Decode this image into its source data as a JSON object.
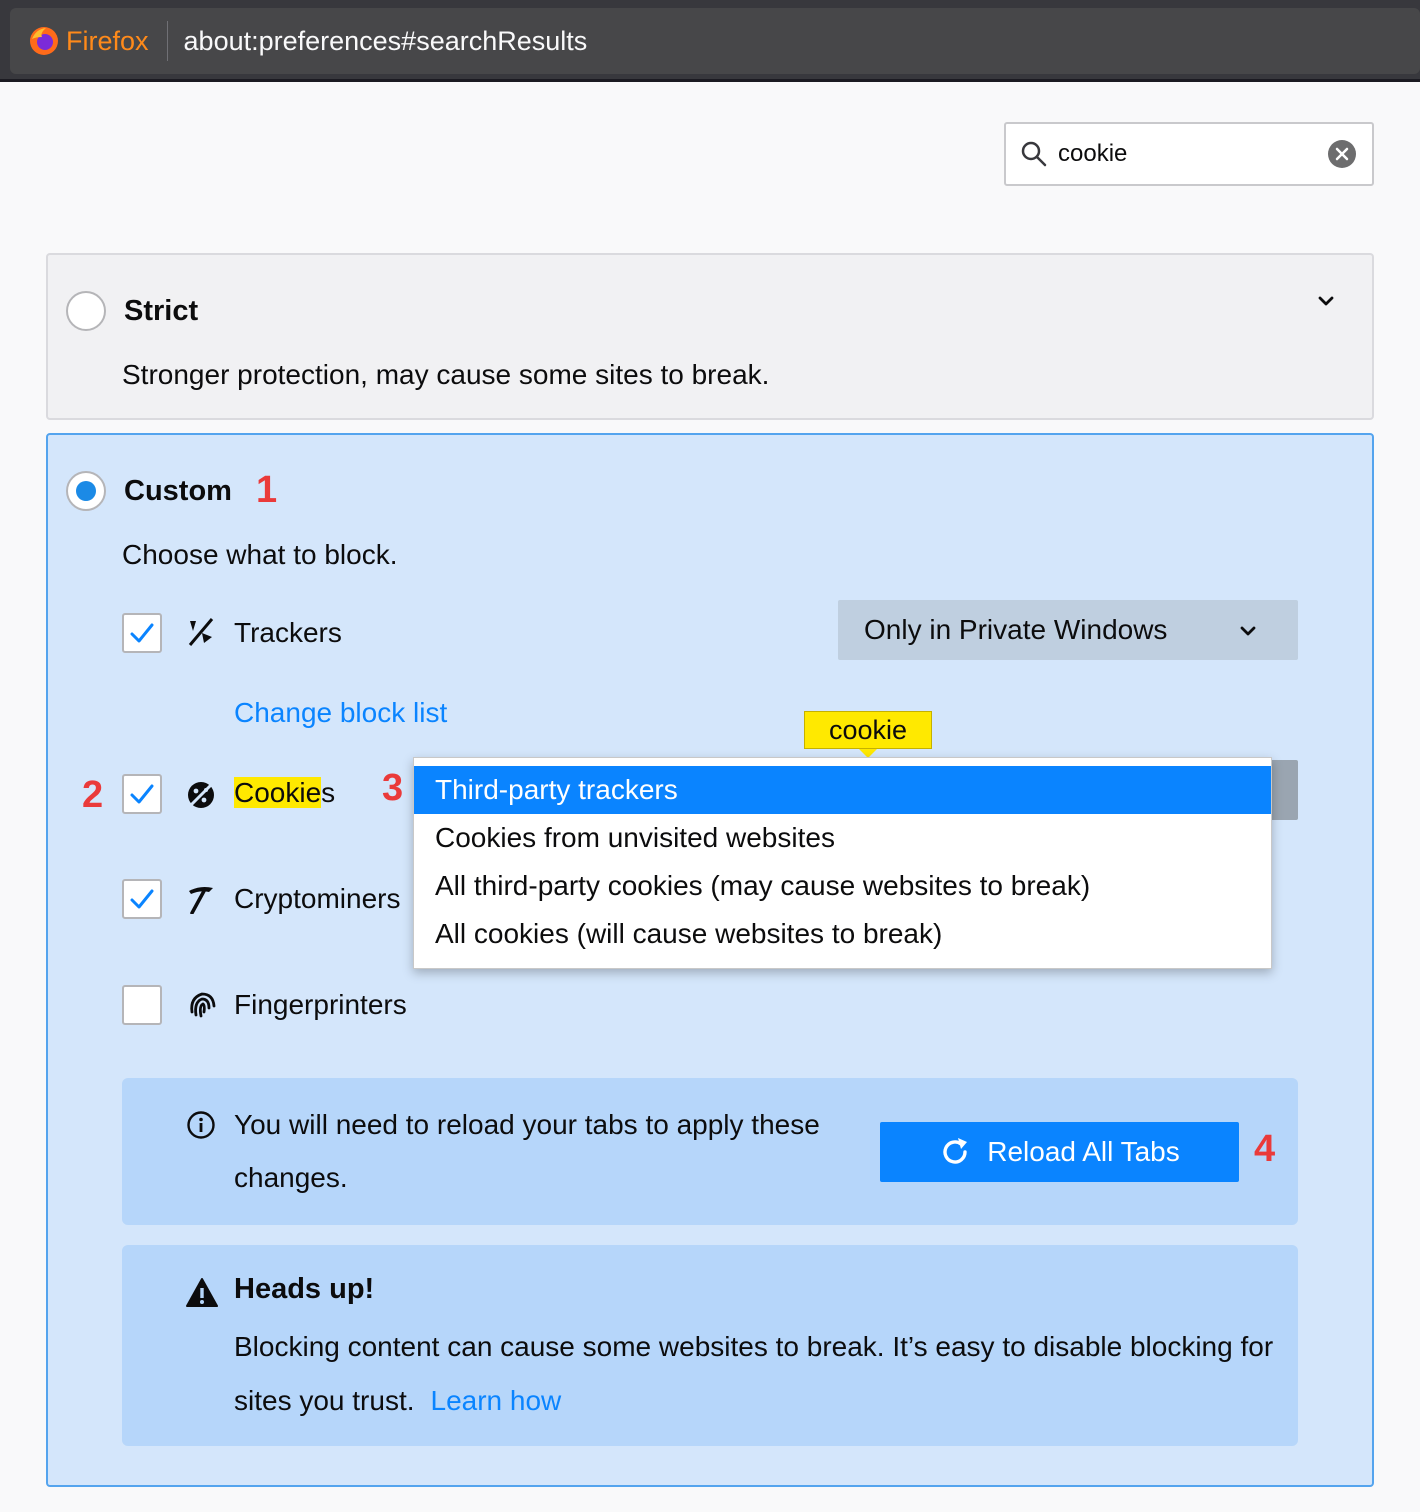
{
  "browser": {
    "brand": "Firefox",
    "url": "about:preferences#searchResults"
  },
  "search": {
    "value": "cookie",
    "icon": "search-icon",
    "clear_icon": "clear-icon"
  },
  "strict": {
    "title": "Strict",
    "description": "Stronger protection, may cause some sites to break.",
    "selected": false
  },
  "custom": {
    "title": "Custom",
    "description": "Choose what to block.",
    "selected": true,
    "annotation": "1"
  },
  "trackers": {
    "label": "Trackers",
    "checked": true,
    "icon": "tracker-icon",
    "select_value": "Only in Private Windows",
    "change_block_list": "Change block list"
  },
  "cookies": {
    "label_highlight": "Cookie",
    "label_rest": "s",
    "checked": true,
    "icon": "cookie-icon",
    "annotation_row": "2",
    "annotation_dropdown": "3",
    "tooltip": "cookie",
    "options": [
      "Third-party trackers",
      "Cookies from unvisited websites",
      "All third-party cookies (may cause websites to break)",
      "All cookies (will cause websites to break)"
    ],
    "selected_index": 0
  },
  "cryptominers": {
    "label": "Cryptominers",
    "checked": true,
    "icon": "cryptominer-icon"
  },
  "fingerprinters": {
    "label": "Fingerprinters",
    "checked": false,
    "icon": "fingerprint-icon"
  },
  "reload": {
    "message": "You will need to reload your tabs to apply these changes.",
    "button_label": "Reload All Tabs",
    "annotation": "4"
  },
  "heads_up": {
    "title": "Heads up!",
    "text": "Blocking content can cause some websites to break. It’s easy to disable blocking for sites you trust.",
    "link": "Learn how"
  },
  "colors": {
    "accent": "#0a84ff",
    "annotation": "#ea3a3a",
    "highlight": "#ffe900",
    "custom_card_bg": "#d4e6fb"
  }
}
